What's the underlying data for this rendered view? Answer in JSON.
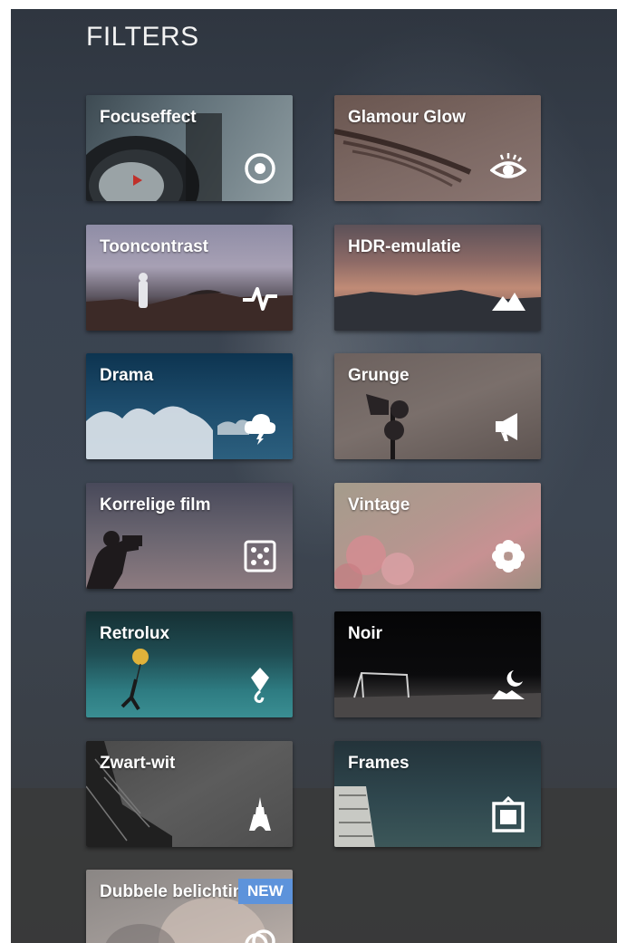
{
  "header": {
    "title": "FILTERS"
  },
  "filters": [
    {
      "label": "Focuseffect",
      "icon": "focus-target-icon"
    },
    {
      "label": "Glamour Glow",
      "icon": "eye-icon"
    },
    {
      "label": "Tooncontrast",
      "icon": "pulse-icon"
    },
    {
      "label": "HDR-emulatie",
      "icon": "mountains-icon"
    },
    {
      "label": "Drama",
      "icon": "storm-cloud-icon"
    },
    {
      "label": "Grunge",
      "icon": "megaphone-icon"
    },
    {
      "label": "Korrelige film",
      "icon": "dice-icon"
    },
    {
      "label": "Vintage",
      "icon": "flower-icon"
    },
    {
      "label": "Retrolux",
      "icon": "kite-icon"
    },
    {
      "label": "Noir",
      "icon": "moon-landscape-icon"
    },
    {
      "label": "Zwart-wit",
      "icon": "eiffel-tower-icon"
    },
    {
      "label": "Frames",
      "icon": "frame-icon"
    },
    {
      "label": "Dubbele belichting",
      "icon": "double-exposure-icon",
      "badge": "NEW"
    }
  ]
}
